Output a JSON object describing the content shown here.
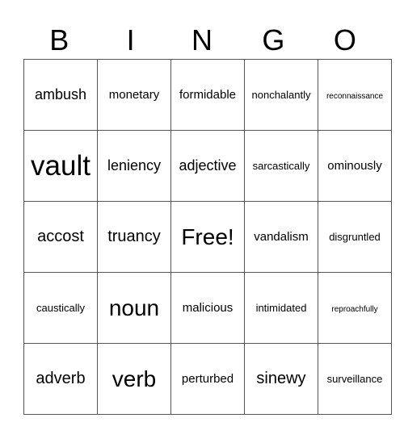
{
  "header": [
    "B",
    "I",
    "N",
    "G",
    "O"
  ],
  "grid": [
    [
      {
        "text": "ambush",
        "size": "lg"
      },
      {
        "text": "monetary",
        "size": "md"
      },
      {
        "text": "formidable",
        "size": "md"
      },
      {
        "text": "nonchalantly",
        "size": "sm"
      },
      {
        "text": "reconnaissance",
        "size": "xs"
      }
    ],
    [
      {
        "text": "vault",
        "size": "xxl"
      },
      {
        "text": "leniency",
        "size": "lg"
      },
      {
        "text": "adjective",
        "size": "lg"
      },
      {
        "text": "sarcastically",
        "size": "sm"
      },
      {
        "text": "ominously",
        "size": "md"
      }
    ],
    [
      {
        "text": "accost",
        "size": "lg2"
      },
      {
        "text": "truancy",
        "size": "lg2"
      },
      {
        "text": "Free!",
        "size": "xl"
      },
      {
        "text": "vandalism",
        "size": "md"
      },
      {
        "text": "disgruntled",
        "size": "sm"
      }
    ],
    [
      {
        "text": "caustically",
        "size": "sm"
      },
      {
        "text": "noun",
        "size": "xl"
      },
      {
        "text": "malicious",
        "size": "md"
      },
      {
        "text": "intimidated",
        "size": "sm"
      },
      {
        "text": "reproachfully",
        "size": "xs"
      }
    ],
    [
      {
        "text": "adverb",
        "size": "lg2"
      },
      {
        "text": "verb",
        "size": "xl"
      },
      {
        "text": "perturbed",
        "size": "md"
      },
      {
        "text": "sinewy",
        "size": "lg2"
      },
      {
        "text": "surveillance",
        "size": "sm"
      }
    ]
  ]
}
